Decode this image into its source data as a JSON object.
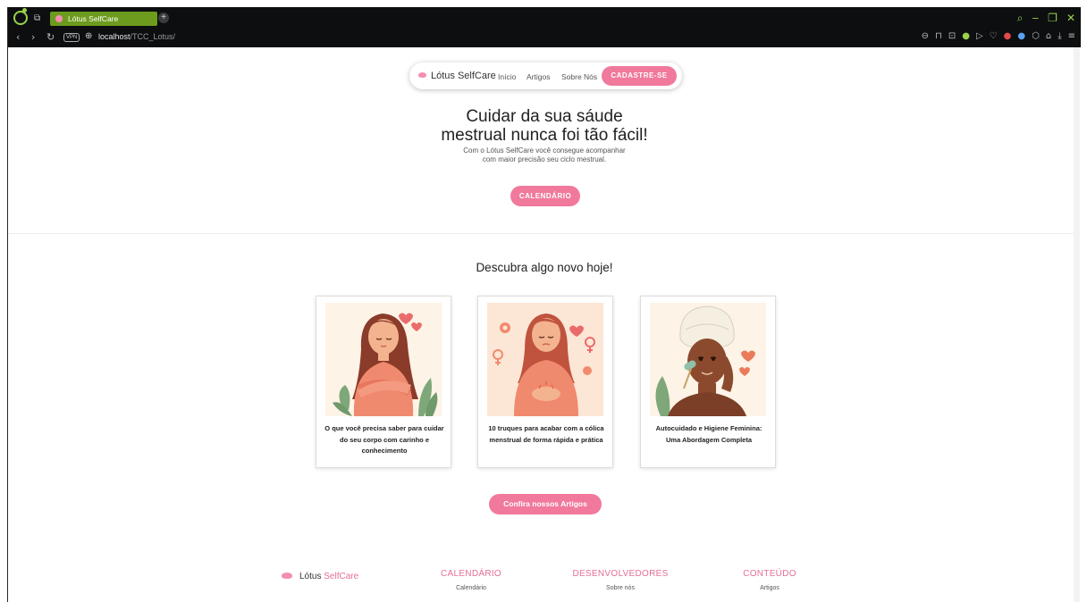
{
  "browser": {
    "tab_title": "Lótus SelfCare",
    "new_tab_symbol": "+",
    "url_host": "localhost",
    "url_path": "/TCC_Lotus/",
    "vpn_label": "VPN"
  },
  "navbar": {
    "brand": "Lótus SelfCare",
    "links": [
      "Início",
      "Artigos",
      "Sobre Nós"
    ],
    "cta": "CADASTRE-SE"
  },
  "hero": {
    "title_line1": "Cuidar da sua sáude",
    "title_line2": "mestrual nunca foi tão fácil!",
    "subtitle_line1": "Com o Lótus SelfCare você consegue acompanhar",
    "subtitle_line2": "com maior precisão seu ciclo mestrual.",
    "button": "CALENDÁRIO"
  },
  "discover": {
    "title": "Descubra algo novo hoje!",
    "cards": [
      {
        "title": "O que você precisa saber para cuidar do seu corpo com carinho e conhecimento"
      },
      {
        "title": "10 truques para acabar com a cólica menstrual de forma rápida e prática"
      },
      {
        "title": "Autocuidado e Higiene Feminina: Uma Abordagem Completa"
      }
    ],
    "button": "Confira nossos Artigos"
  },
  "footer": {
    "brand_part1": "Lótus",
    "brand_part2": "SelfCare",
    "columns": [
      {
        "heading": "CALENDÁRIO",
        "link": "Calendário"
      },
      {
        "heading": "DESENVOLVEDORES",
        "link": "Sobre nós"
      },
      {
        "heading": "CONTEÚDO",
        "link": "Artigos"
      }
    ]
  },
  "colors": {
    "accent_pink": "#f0799c",
    "browser_green": "#9ad34a",
    "browser_bg": "#0c0e10"
  }
}
